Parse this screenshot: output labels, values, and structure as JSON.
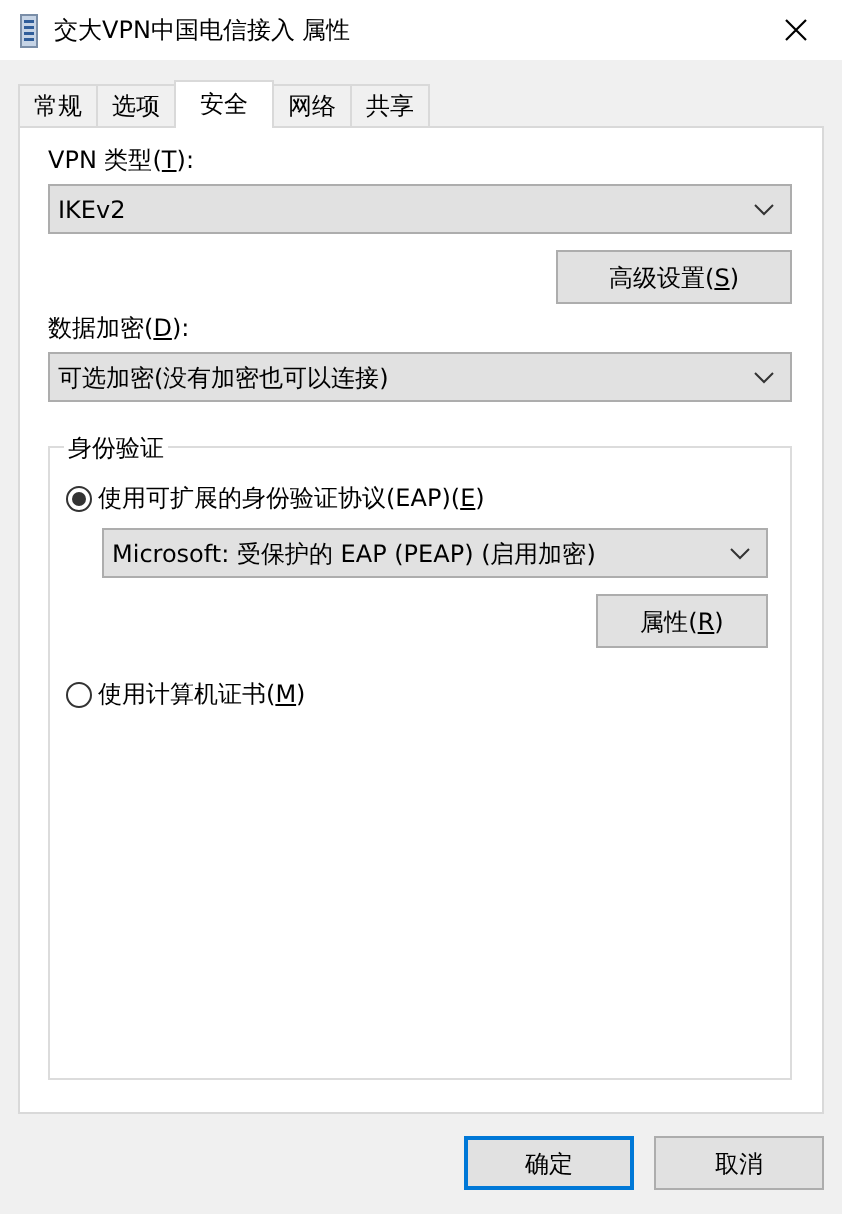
{
  "window": {
    "title": "交大VPN中国电信接入 属性"
  },
  "tabs": [
    {
      "label": "常规",
      "selected": false
    },
    {
      "label": "选项",
      "selected": false
    },
    {
      "label": "安全",
      "selected": true
    },
    {
      "label": "网络",
      "selected": false
    },
    {
      "label": "共享",
      "selected": false
    }
  ],
  "vpn_type": {
    "label": {
      "before": "VPN 类型(",
      "key": "T",
      "after": "):"
    },
    "value": "IKEv2"
  },
  "advanced_button": {
    "before": "高级设置(",
    "key": "S",
    "after": ")"
  },
  "encryption": {
    "label": {
      "before": "数据加密(",
      "key": "D",
      "after": "):"
    },
    "value": "可选加密(没有加密也可以连接)"
  },
  "authentication": {
    "title": "身份验证",
    "options": [
      {
        "before": "使用可扩展的身份验证协议(EAP)(",
        "key": "E",
        "after": ")",
        "selected": true,
        "kind": "eap"
      },
      {
        "before": "使用计算机证书(",
        "key": "M",
        "after": ")",
        "selected": false,
        "kind": "plain"
      }
    ],
    "eap_method": "Microsoft: 受保护的 EAP (PEAP) (启用加密)",
    "properties_button": {
      "before": "属性(",
      "key": "R",
      "after": ")"
    }
  },
  "buttons": [
    {
      "label": "确定",
      "default": true
    },
    {
      "label": "取消",
      "default": false
    }
  ]
}
